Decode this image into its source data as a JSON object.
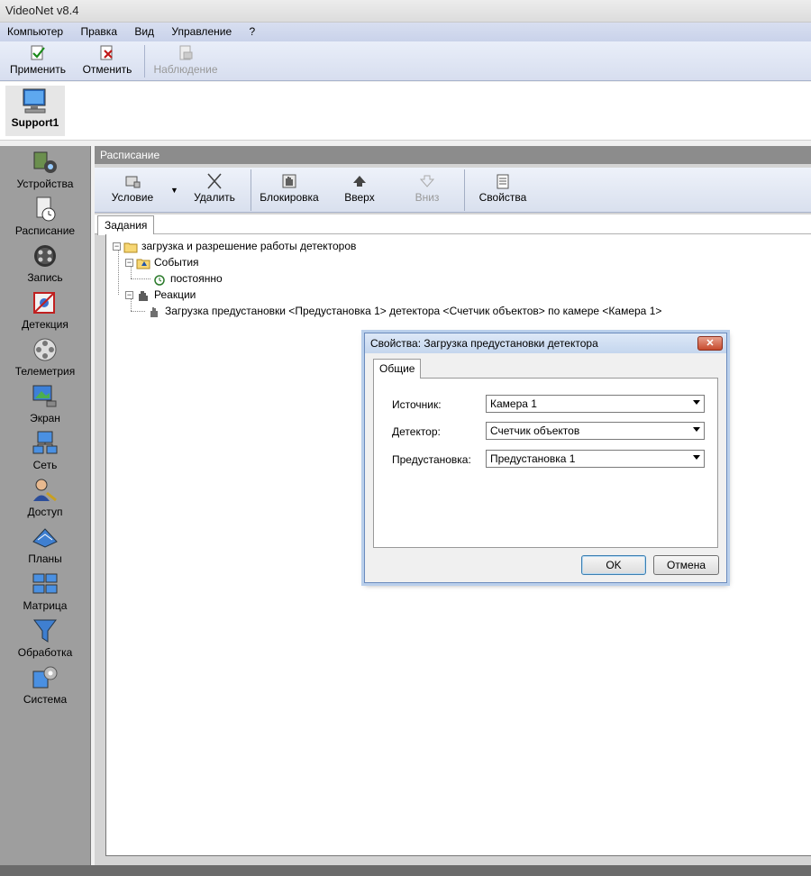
{
  "window": {
    "title": "VideoNet v8.4"
  },
  "menu": [
    "Компьютер",
    "Правка",
    "Вид",
    "Управление",
    "?"
  ],
  "toolbar": {
    "apply": "Применить",
    "cancel": "Отменить",
    "watch": "Наблюдение"
  },
  "computer": {
    "name": "Support1"
  },
  "nav": [
    "Устройства",
    "Расписание",
    "Запись",
    "Детекция",
    "Телеметрия",
    "Экран",
    "Сеть",
    "Доступ",
    "Планы",
    "Матрица",
    "Обработка",
    "Система"
  ],
  "content": {
    "header": "Расписание",
    "toolbar": {
      "condition": "Условие",
      "delete": "Удалить",
      "block": "Блокировка",
      "up": "Вверх",
      "down": "Вниз",
      "properties": "Свойства"
    },
    "tab": "Задания"
  },
  "tree": {
    "root": "загрузка и разрешение работы детекторов",
    "events": "События",
    "event_item": "постоянно",
    "reactions": "Реакции",
    "reaction_item": "Загрузка предустановки <Предустановка 1> детектора <Счетчик объектов> по камере <Камера 1>"
  },
  "dialog": {
    "title": "Свойства: Загрузка предустановки детектора",
    "tab": "Общие",
    "source_label": "Источник:",
    "source_value": "Камера  1",
    "detector_label": "Детектор:",
    "detector_value": "Счетчик объектов",
    "preset_label": "Предустановка:",
    "preset_value": "Предустановка 1",
    "ok": "OK",
    "cancel": "Отмена"
  }
}
